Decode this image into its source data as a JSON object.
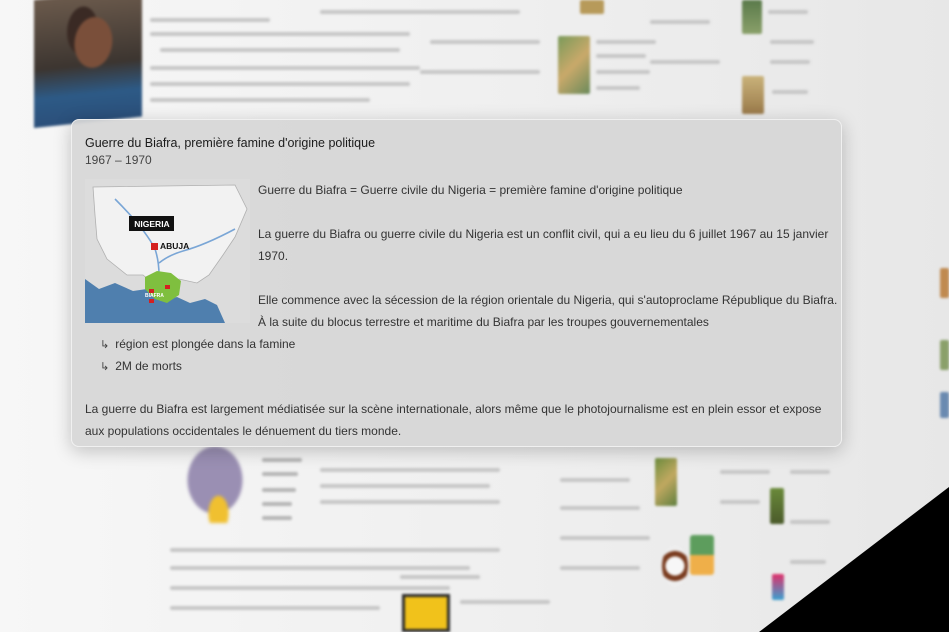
{
  "popup": {
    "title": "Guerre du Biafra, première famine d'origine politique",
    "dates": "1967 – 1970",
    "map": {
      "country_label": "NIGERIA",
      "capital_label": "ABUJA",
      "region_label": "BIAFRA"
    },
    "paragraph_1": "Guerre du Biafra = Guerre civile du Nigeria = première famine d'origine politique",
    "paragraph_2_line_1": "La guerre du Biafra ou guerre civile du Nigeria est un conflit civil, qui a eu lieu du 6 juillet 1967 au 15 janvier",
    "paragraph_2_line_2": "1970.",
    "paragraph_3_line_1": "Elle commence avec la sécession de la région orientale du Nigeria, qui s'autoproclame République du Biafra.",
    "paragraph_3_line_2": "À la suite du blocus terrestre et maritime du Biafra par les troupes gouvernementales",
    "consequence_1": "région est plongée dans la famine",
    "consequence_2": "2M de morts",
    "footer_line_1": "La guerre du Biafra est largement médiatisée sur la scène internationale, alors même que le photojournalisme est en plein essor et expose",
    "footer_line_2": "aux populations occidentales le dénuement du tiers monde.",
    "arrow_glyph": "↳"
  },
  "colors": {
    "card_background": "#d6d6d6",
    "map_sea": "#4f7fae",
    "map_land": "#f2f2f2",
    "map_biafra": "#7fbf3f",
    "capital_marker": "#d42020"
  }
}
